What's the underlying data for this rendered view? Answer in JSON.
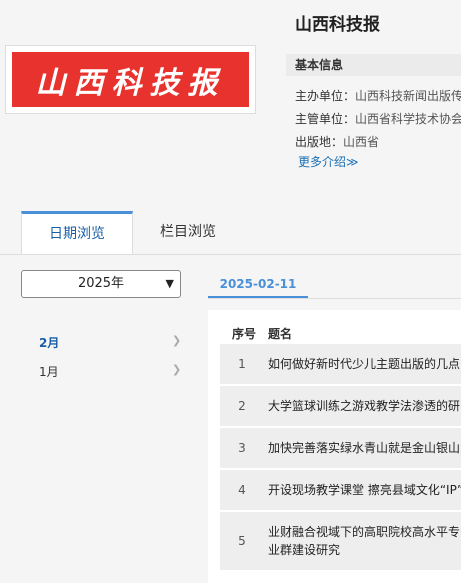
{
  "newspaper": {
    "title": "山西科技报",
    "cover_text": "山西科技报"
  },
  "info": {
    "heading": "基本信息",
    "rows": [
      {
        "label": "主办单位：",
        "value": "山西科技新闻出版传"
      },
      {
        "label": "主管单位：",
        "value": "山西省科学技术协会"
      },
      {
        "label": "出版地：",
        "value": "山西省"
      }
    ],
    "more": "更多介绍≫"
  },
  "tabs": {
    "date_browse": "日期浏览",
    "column_browse": "栏目浏览"
  },
  "year_select": {
    "value": "2025年"
  },
  "months": [
    {
      "label": "2月",
      "active": true
    },
    {
      "label": "1月",
      "active": false
    }
  ],
  "date_tab": "2025-02-11",
  "table": {
    "headers": {
      "index": "序号",
      "title": "题名"
    },
    "rows": [
      {
        "index": "1",
        "title": "如何做好新时代少儿主题出版的几点"
      },
      {
        "index": "2",
        "title": "大学篮球训练之游戏教学法渗透的研"
      },
      {
        "index": "3",
        "title": "加快完善落实绿水青山就是金山银山"
      },
      {
        "index": "4",
        "title": "开设现场教学课堂 擦亮县域文化“IP”"
      },
      {
        "index": "5",
        "title": "业财融合视域下的高职院校高水平专业群建设研究"
      }
    ]
  },
  "icons": {
    "select_chevron": "chevron-down-icon",
    "month_arrow": "chevron-right-icon"
  }
}
